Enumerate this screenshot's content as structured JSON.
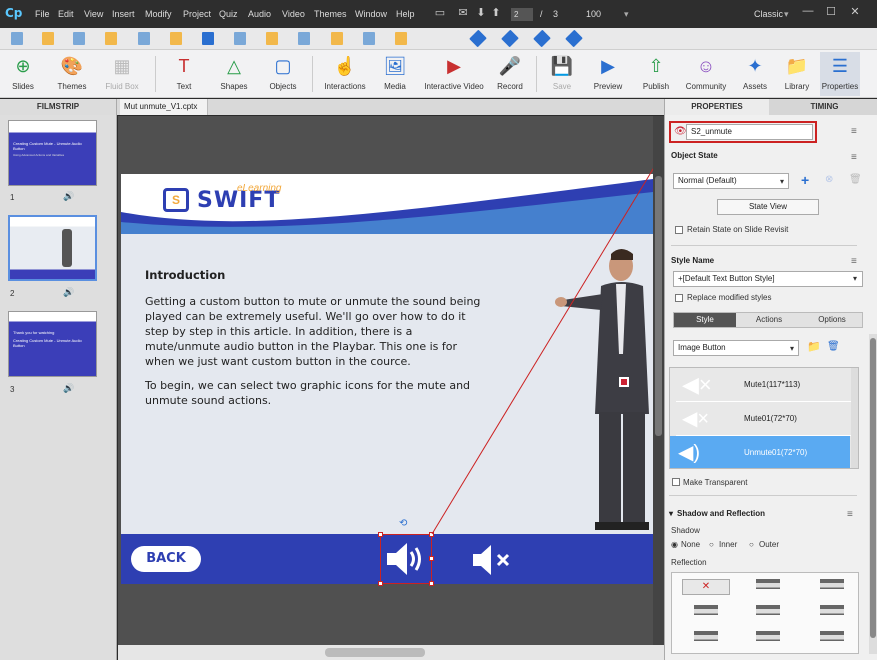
{
  "app": {
    "logo": "Cp",
    "menus": [
      "File",
      "Edit",
      "View",
      "Insert",
      "Modify",
      "Project",
      "Quiz",
      "Audio",
      "Video",
      "Themes",
      "Window",
      "Help"
    ],
    "page_current": "2",
    "page_sep": "/",
    "page_total": "3",
    "zoom": "100",
    "workspace": "Classic"
  },
  "toolbar": {
    "items": [
      "Slides",
      "Themes",
      "Fluid Box",
      "Text",
      "Shapes",
      "Objects",
      "Interactions",
      "Media",
      "Interactive Video",
      "Record",
      "Save",
      "Preview",
      "Publish",
      "Community",
      "Assets",
      "Library",
      "Properties"
    ]
  },
  "filmstrip": {
    "title": "FILMSTRIP",
    "slides": [
      {
        "num": "1",
        "title": "Creating Custom Mute - Unmute Audio Button",
        "subtitle": "Using Advanced Actions and Variables"
      },
      {
        "num": "2"
      },
      {
        "num": "3",
        "title": "Thank you for watching",
        "subtitle": "Creating Custom Mute - Unmute Audio Button"
      }
    ]
  },
  "document": {
    "tab": "Mut unmute_V1.cptx"
  },
  "slide": {
    "logo_main": "SWIFT",
    "logo_sub": "eLearning",
    "heading": "Introduction",
    "para1": "Getting a custom button to mute or unmute the sound being played can be extremely useful. We'll go over how to do it step by step in this article. In addition, there is a mute/unmute audio button in the Playbar. This one is for when we just want custom button in the cource.",
    "para2": "To begin, we can select two graphic icons for the mute and unmute sound actions.",
    "back": "BACK"
  },
  "properties": {
    "tab_properties": "PROPERTIES",
    "tab_timing": "TIMING",
    "object_name": "S2_unmute",
    "object_state_label": "Object State",
    "state_value": "Normal (Default)",
    "state_view": "State View",
    "retain_state": "Retain State on Slide Revisit",
    "style_name_label": "Style Name",
    "style_value": "+[Default Text Button Style]",
    "replace_styles": "Replace modified styles",
    "subtabs": [
      "Style",
      "Actions",
      "Options"
    ],
    "button_type": "Image Button",
    "images": [
      "Mute1(117*113)",
      "Mute01(72*70)",
      "Unmute01(72*70)"
    ],
    "make_transparent": "Make Transparent",
    "shadow_reflection": "Shadow and Reflection",
    "shadow_label": "Shadow",
    "shadow_opts": [
      "None",
      "Inner",
      "Outer"
    ],
    "reflection_label": "Reflection"
  },
  "colors": {
    "accent": "#2e3fb2",
    "selection": "#cc2222"
  }
}
